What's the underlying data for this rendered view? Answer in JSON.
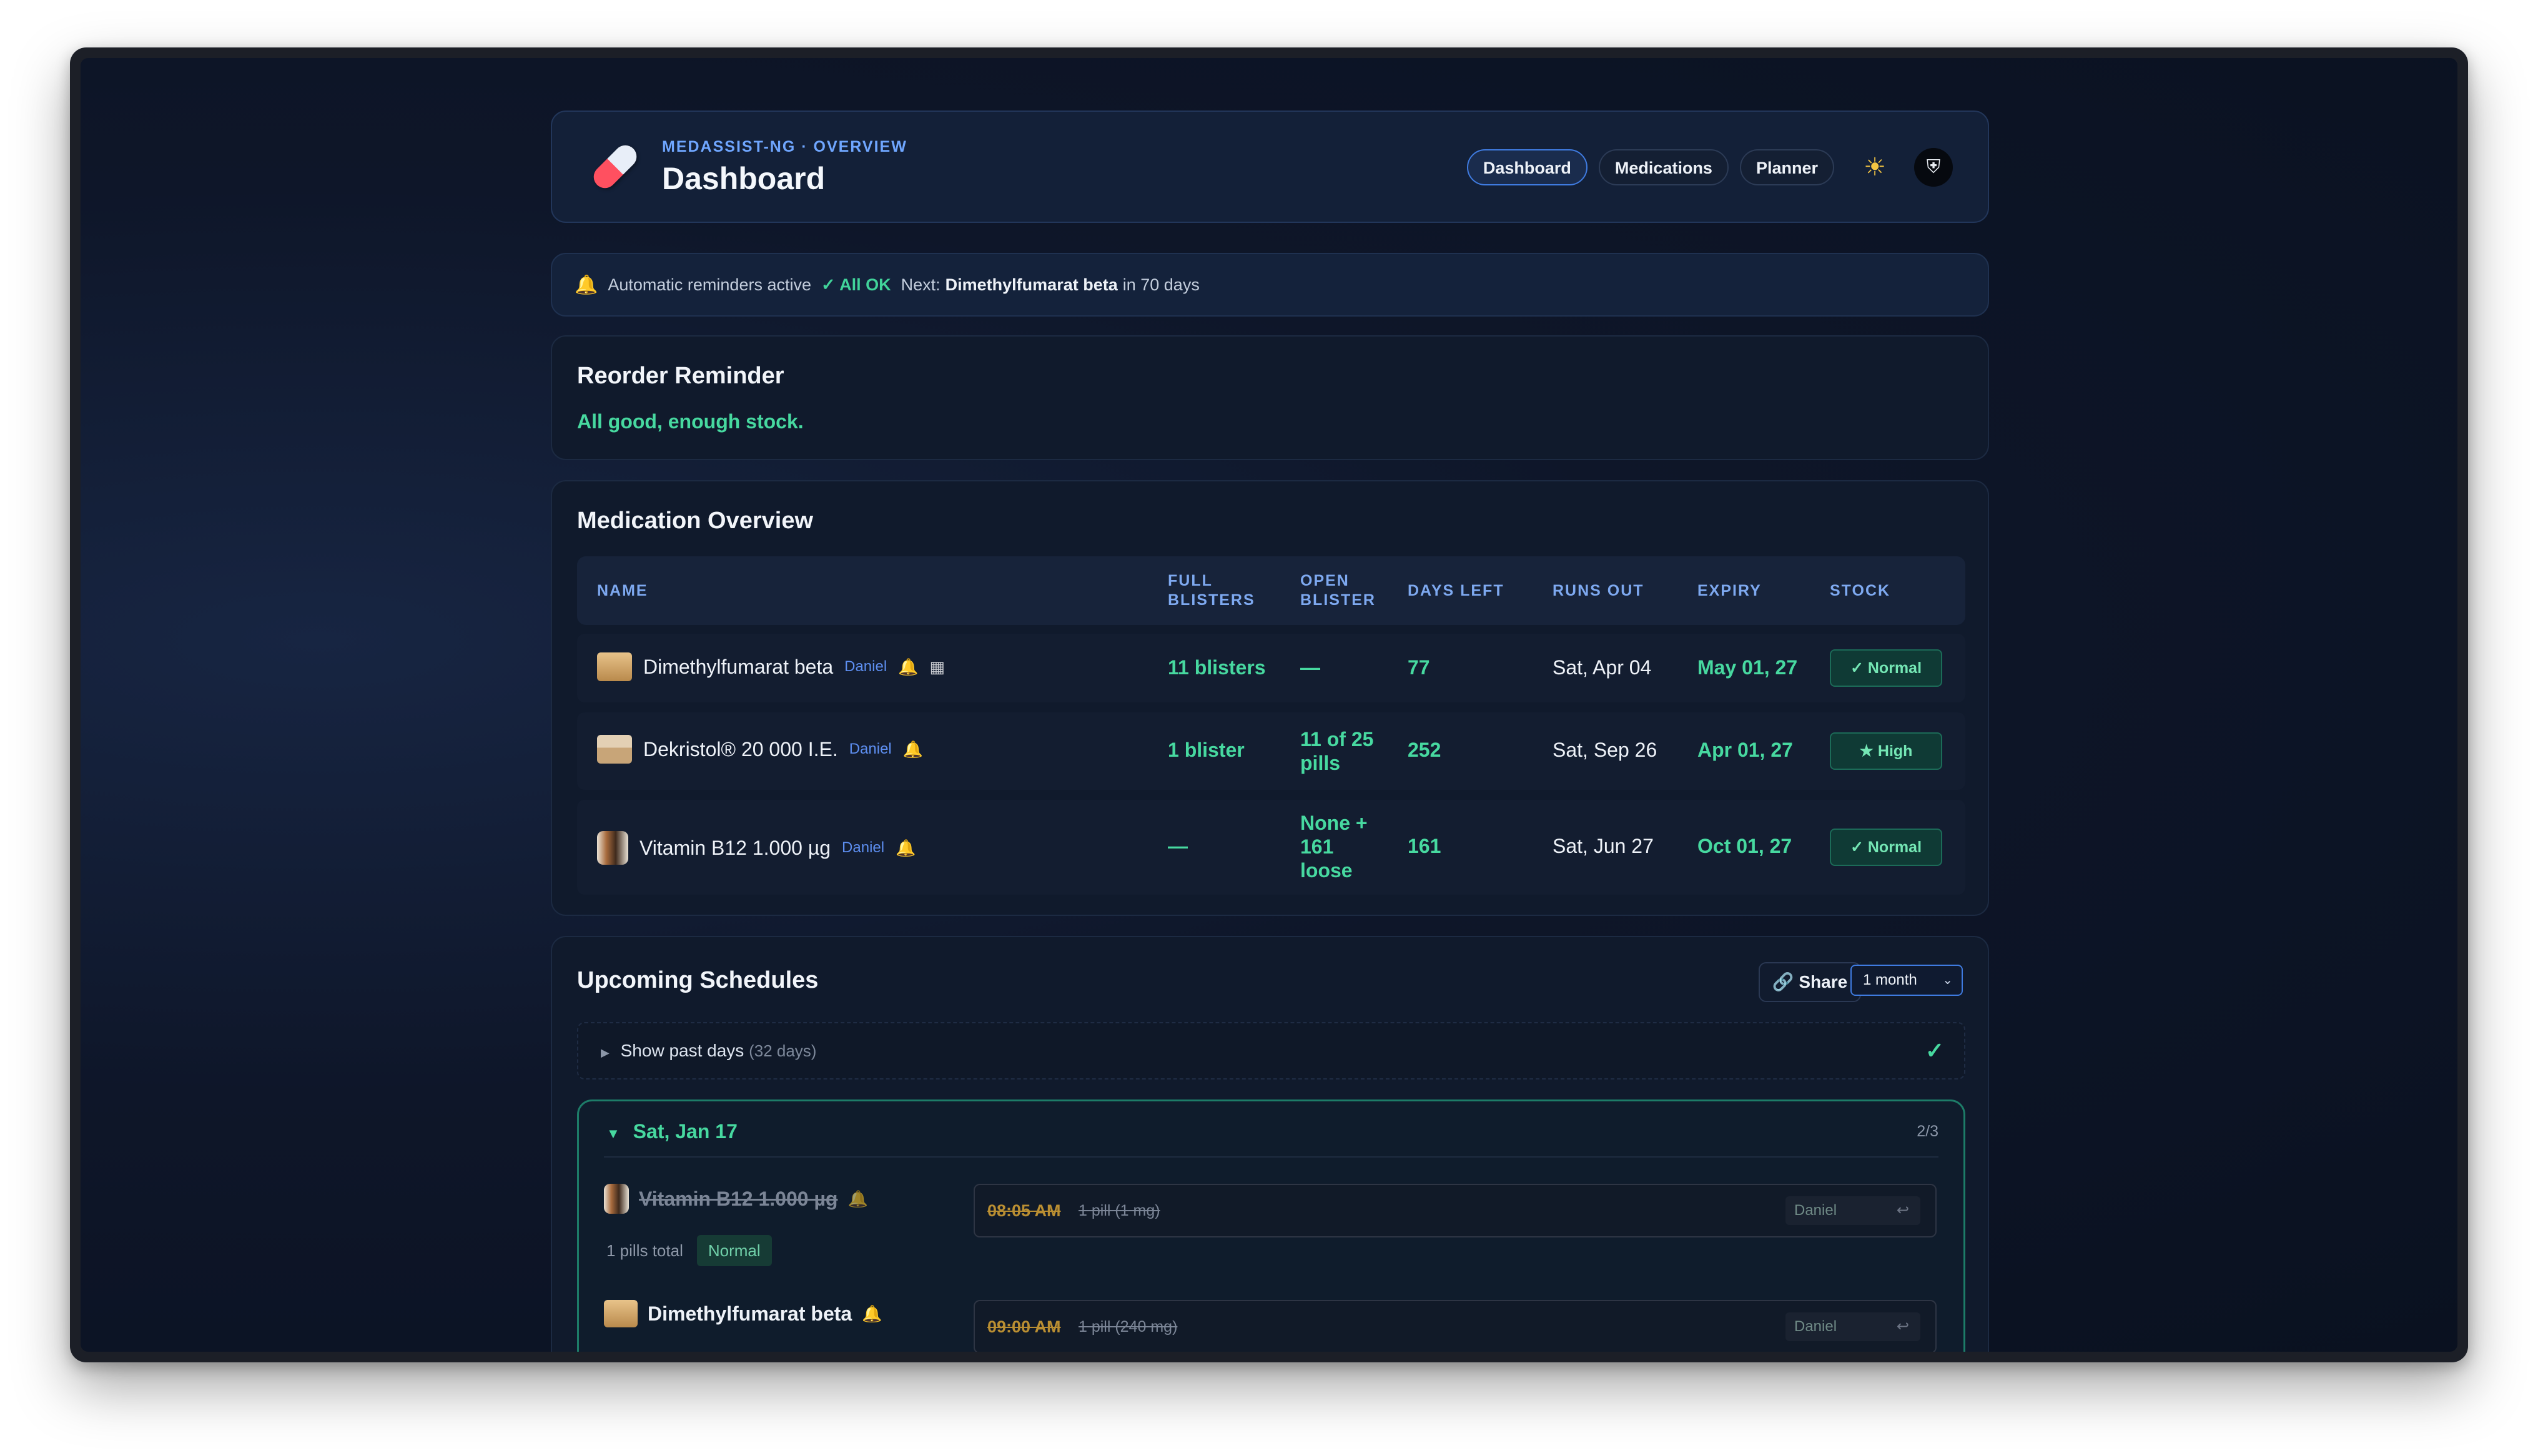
{
  "header": {
    "crumb": "MEDASSIST-NG · OVERVIEW",
    "title": "Dashboard",
    "nav": [
      "Dashboard",
      "Medications",
      "Planner"
    ],
    "active_nav": "Dashboard",
    "theme_icon": "☀",
    "avatar_icon": "⛨"
  },
  "banner": {
    "text": "Automatic reminders active",
    "status": "✓ All OK",
    "next_label": "Next:",
    "next_med": "Dimethylfumarat beta",
    "next_when": "in 70 days"
  },
  "reorder": {
    "title": "Reorder Reminder",
    "message": "All good, enough stock."
  },
  "overview": {
    "title": "Medication Overview",
    "columns": [
      "NAME",
      "FULL BLISTERS",
      "OPEN BLISTER",
      "DAYS LEFT",
      "RUNS OUT",
      "EXPIRY",
      "STOCK"
    ],
    "rows": [
      {
        "name": "Dimethylfumarat beta",
        "owner": "Daniel",
        "full": "11 blisters",
        "open": "—",
        "days": "77",
        "runs_out": "Sat, Apr 04",
        "expiry": "May 01, 27",
        "stock": "✓ Normal"
      },
      {
        "name": "Dekristol® 20 000 I.E.",
        "owner": "Daniel",
        "full": "1 blister",
        "open": "11 of 25 pills",
        "days": "252",
        "runs_out": "Sat, Sep 26",
        "expiry": "Apr 01, 27",
        "stock": "★ High"
      },
      {
        "name": "Vitamin B12 1.000 µg",
        "owner": "Daniel",
        "full": "—",
        "open": "None + 161 loose",
        "days": "161",
        "runs_out": "Sat, Jun 27",
        "expiry": "Oct 01, 27",
        "stock": "✓ Normal"
      }
    ]
  },
  "schedules": {
    "title": "Upcoming Schedules",
    "share_label": "Share",
    "range": "1 month",
    "past_label": "Show past days",
    "past_count": "(32 days)",
    "day": {
      "label": "Sat, Jan 17",
      "progress": "2/3",
      "entries": [
        {
          "name": "Vitamin B12 1.000 µg",
          "time": "08:05 AM",
          "amount": "1 pill (1 mg)",
          "owner": "Daniel",
          "total": "1 pills total",
          "stock": "Normal"
        },
        {
          "name": "Dimethylfumarat beta",
          "time": "09:00 AM",
          "amount": "1 pill (240 mg)",
          "owner": "Daniel"
        }
      ]
    }
  }
}
